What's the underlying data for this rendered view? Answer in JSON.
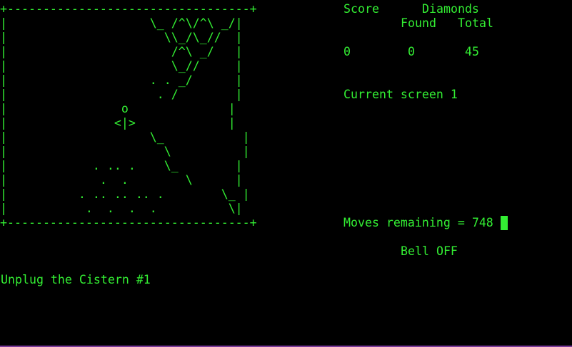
{
  "playfield": {
    "rows": [
      "+----------------------------------+",
      "|                    \\_ /^\\/^\\ _/|",
      "|                      \\\\_/\\_//  |",
      "|                       /^\\ _/   |",
      "|                       \\_//     |",
      "|                    . . _/      |",
      "|                     . /        |",
      "|                o              |",
      "|               <|>             |",
      "|                    \\_           |",
      "|                      \\          |",
      "|            . .. .    \\_        |",
      "|             .  .        \\      |",
      "|          . .. .. .. .        \\_ |",
      "|           .  .  .  .          \\|",
      "+----------------------------------+"
    ]
  },
  "status": {
    "score_header": "Score",
    "diamonds_header": "Diamonds",
    "found_header": "Found",
    "total_header": "Total",
    "score": "0",
    "found": "0",
    "total": "45",
    "current_screen": "Current screen 1",
    "moves_remaining": "Moves remaining = 748",
    "bell": "Bell OFF"
  },
  "level_name": "Unplug the Cistern #1",
  "colors": {
    "foreground": "#33ee33",
    "background": "#000000"
  }
}
